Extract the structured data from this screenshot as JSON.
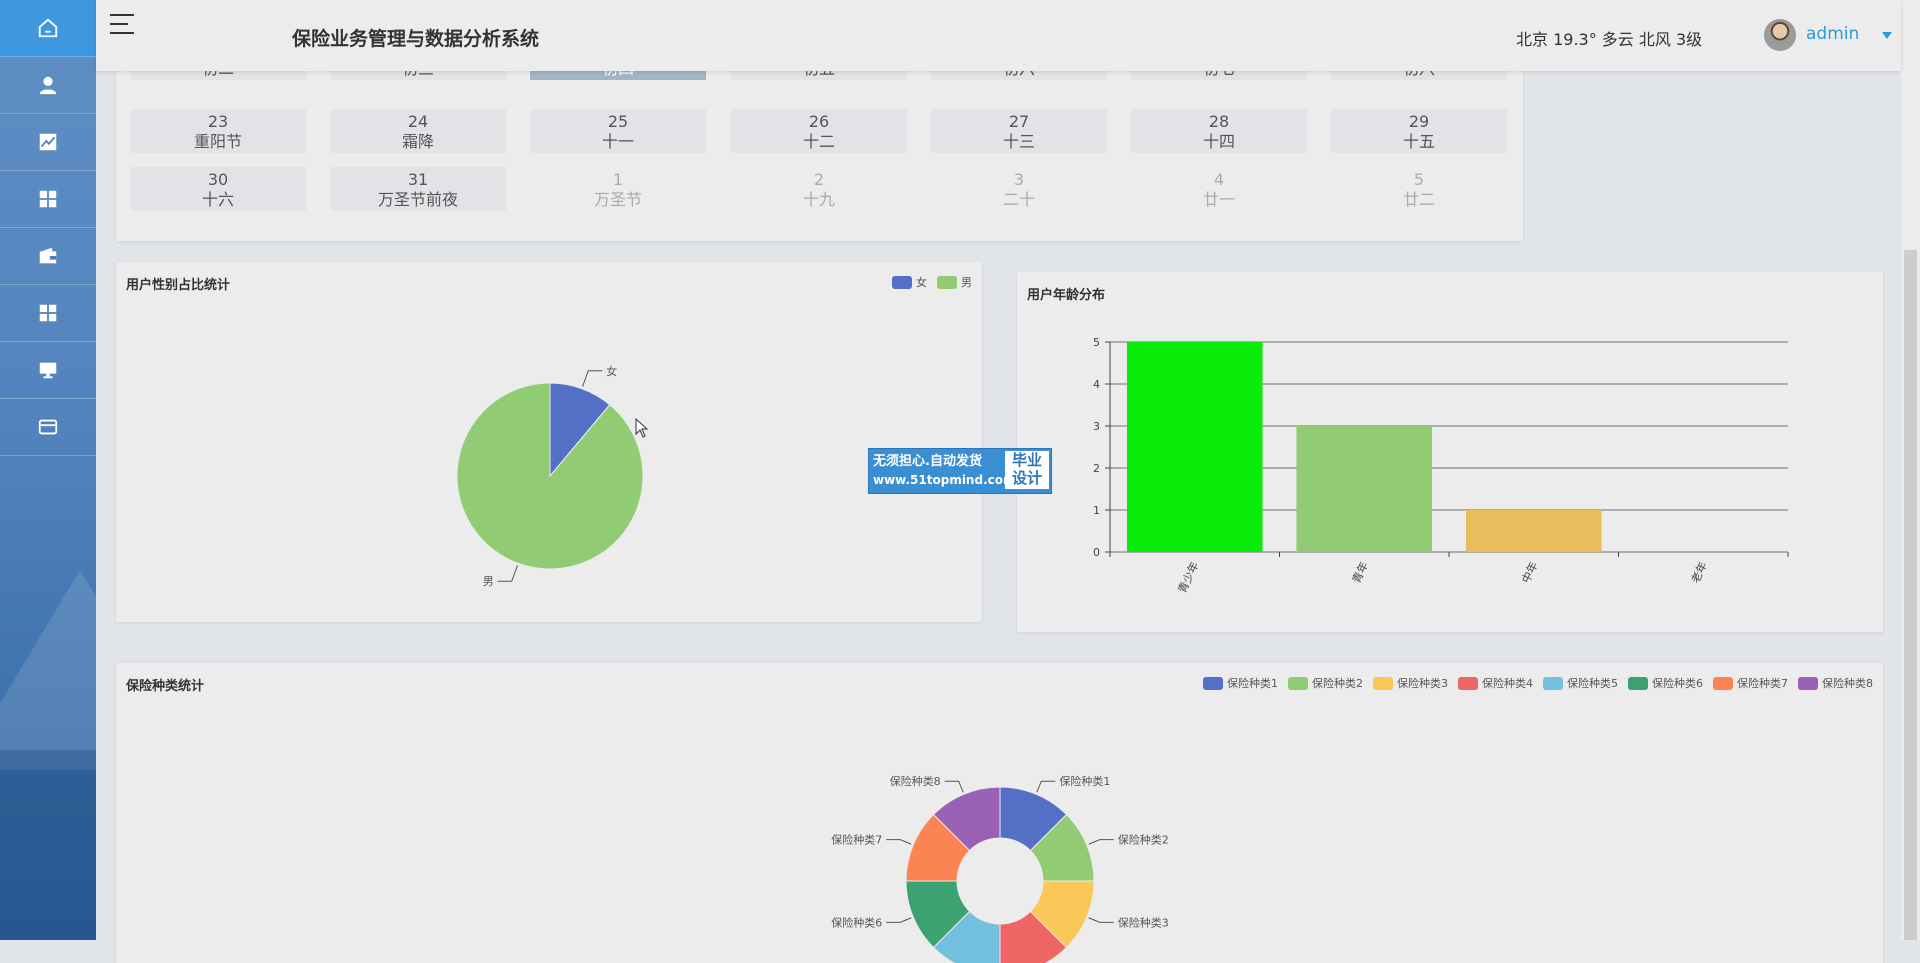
{
  "app": {
    "title": "保险业务管理与数据分析系统",
    "weather": "北京  19.3°  多云  北风  3级",
    "user": "admin"
  },
  "sidebar": {
    "items": [
      {
        "icon": "home-icon",
        "active": true
      },
      {
        "icon": "user-icon",
        "active": false
      },
      {
        "icon": "line-chart-icon",
        "active": false
      },
      {
        "icon": "grid-icon",
        "active": false
      },
      {
        "icon": "wallet-icon",
        "active": false
      },
      {
        "icon": "apps-icon",
        "active": false
      },
      {
        "icon": "monitor-icon",
        "active": false
      },
      {
        "icon": "card-icon",
        "active": false
      }
    ]
  },
  "calendar": {
    "top_row": [
      "初二",
      "初三",
      "初四",
      "初五",
      "初六",
      "初七",
      "初八"
    ],
    "selected_top": 2,
    "rows": [
      [
        {
          "d": "23",
          "l": "重阳节",
          "other": false
        },
        {
          "d": "24",
          "l": "霜降",
          "other": false
        },
        {
          "d": "25",
          "l": "十一",
          "other": false
        },
        {
          "d": "26",
          "l": "十二",
          "other": false
        },
        {
          "d": "27",
          "l": "十三",
          "other": false
        },
        {
          "d": "28",
          "l": "十四",
          "other": false
        },
        {
          "d": "29",
          "l": "十五",
          "other": false
        }
      ],
      [
        {
          "d": "30",
          "l": "十六",
          "other": false
        },
        {
          "d": "31",
          "l": "万圣节前夜",
          "other": false
        },
        {
          "d": "1",
          "l": "万圣节",
          "other": true
        },
        {
          "d": "2",
          "l": "十九",
          "other": true
        },
        {
          "d": "3",
          "l": "二十",
          "other": true
        },
        {
          "d": "4",
          "l": "廿一",
          "other": true
        },
        {
          "d": "5",
          "l": "廿二",
          "other": true
        }
      ]
    ]
  },
  "gender_chart": {
    "title": "用户性别占比统计",
    "legend": [
      {
        "name": "女",
        "color": "#5470c6"
      },
      {
        "name": "男",
        "color": "#91cc75"
      }
    ]
  },
  "age_chart": {
    "title": "用户年龄分布"
  },
  "types_chart": {
    "title": "保险种类统计",
    "legend": [
      {
        "name": "保险种类1",
        "color": "#5470c6"
      },
      {
        "name": "保险种类2",
        "color": "#91cc75"
      },
      {
        "name": "保险种类3",
        "color": "#fac858"
      },
      {
        "name": "保险种类4",
        "color": "#ee6666"
      },
      {
        "name": "保险种类5",
        "color": "#73c0de"
      },
      {
        "name": "保险种类6",
        "color": "#3ba272"
      },
      {
        "name": "保险种类7",
        "color": "#fc8452"
      },
      {
        "name": "保险种类8",
        "color": "#9a60b4"
      }
    ]
  },
  "watermark": {
    "line1": "无须担心.自动发货",
    "line2": "www.51topmind.com",
    "badge1": "毕业",
    "badge2": "设计"
  },
  "chart_data": [
    {
      "type": "pie",
      "title": "用户性别占比统计",
      "labels": [
        "女",
        "男"
      ],
      "values": [
        1,
        8
      ],
      "colors": [
        "#5470c6",
        "#91cc75"
      ]
    },
    {
      "type": "bar",
      "title": "用户年龄分布",
      "categories": [
        "青少年",
        "青年",
        "中年",
        "老年"
      ],
      "values": [
        5,
        3,
        1,
        0
      ],
      "colors": [
        "#0aec0a",
        "#91cc75",
        "#e8bd5c",
        "#e06666"
      ],
      "ylim": [
        0,
        5
      ],
      "yticks": [
        0,
        1,
        2,
        3,
        4,
        5
      ]
    },
    {
      "type": "pie",
      "title": "保险种类统计",
      "labels": [
        "保险种类1",
        "保险种类2",
        "保险种类3",
        "保险种类4",
        "保险种类5",
        "保险种类6",
        "保险种类7",
        "保险种类8"
      ],
      "values": [
        1,
        1,
        1,
        1,
        1,
        1,
        1,
        1
      ],
      "colors": [
        "#5470c6",
        "#91cc75",
        "#fac858",
        "#ee6666",
        "#73c0de",
        "#3ba272",
        "#fc8452",
        "#9a60b4"
      ]
    }
  ]
}
